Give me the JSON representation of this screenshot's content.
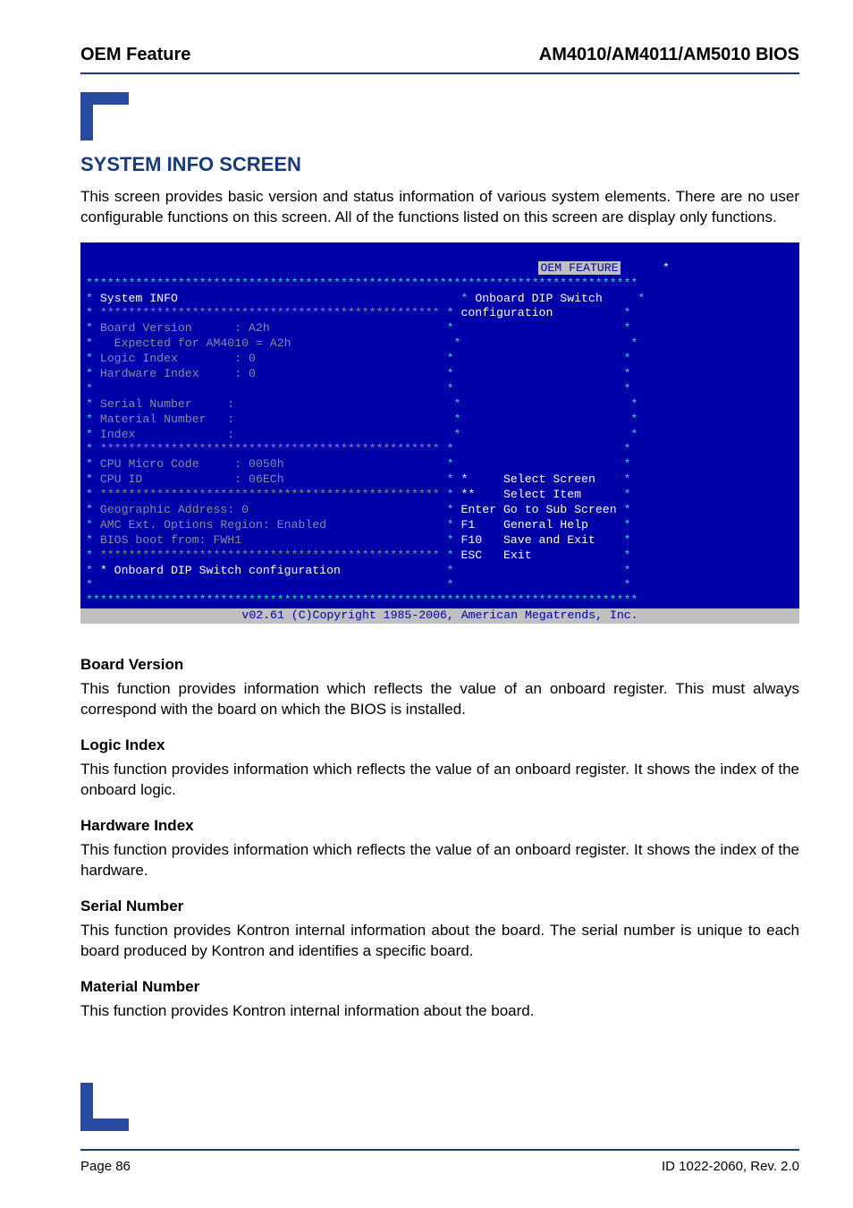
{
  "header": {
    "left": "OEM Feature",
    "right": "AM4010/AM4011/AM5010 BIOS"
  },
  "title": "SYSTEM INFO SCREEN",
  "intro": "This screen provides basic version and status information of various system elements. There are no user configurable functions on this screen. All of the functions listed on this screen are display only functions.",
  "bios": {
    "tag": "OEM FEATURE",
    "section_title": "System INFO",
    "help_line1": "Onboard DIP Switch",
    "help_line2": "configuration",
    "board_version": "Board Version      : A2h",
    "expected": "  Expected for AM4010 = A2h",
    "logic_index": "Logic Index        : 0",
    "hardware_index": "Hardware Index     : 0",
    "serial_number": "Serial Number     :",
    "material_number": "Material Number   :",
    "index": "Index             :",
    "cpu_micro": "CPU Micro Code     : 0050h",
    "cpu_id": "CPU ID             : 06ECh",
    "geo_addr": "Geographic Address: 0",
    "amc_ext": "AMC Ext. Options Region: Enabled",
    "bios_boot": "BIOS boot from: FWH1",
    "dip_sub": "* Onboard DIP Switch configuration",
    "nav": {
      "sel_screen": "Select Screen",
      "sel_item": "Select Item",
      "enter": "Go to Sub Screen",
      "f1": "General Help",
      "f10": "Save and Exit",
      "esc": "Exit"
    },
    "footer": "v02.61 (C)Copyright 1985-2006, American Megatrends, Inc."
  },
  "sections": {
    "board_version": {
      "h": "Board Version",
      "p": "This function provides information which reflects the value of an onboard register. This must always correspond with the board on which the BIOS is installed."
    },
    "logic_index": {
      "h": "Logic Index",
      "p": "This function provides information which reflects the value of an onboard register. It shows the index of the onboard logic."
    },
    "hardware_index": {
      "h": "Hardware Index",
      "p": "This function provides information which reflects the value of an onboard register. It shows the index of the hardware."
    },
    "serial_number": {
      "h": "Serial Number",
      "p": "This function provides Kontron internal information about the board. The serial number is unique to each board produced by Kontron and identifies a specific board."
    },
    "material_number": {
      "h": "Material Number",
      "p": "This function provides Kontron internal information about the board."
    }
  },
  "footer": {
    "left": "Page 86",
    "right": "ID 1022-2060, Rev. 2.0"
  }
}
